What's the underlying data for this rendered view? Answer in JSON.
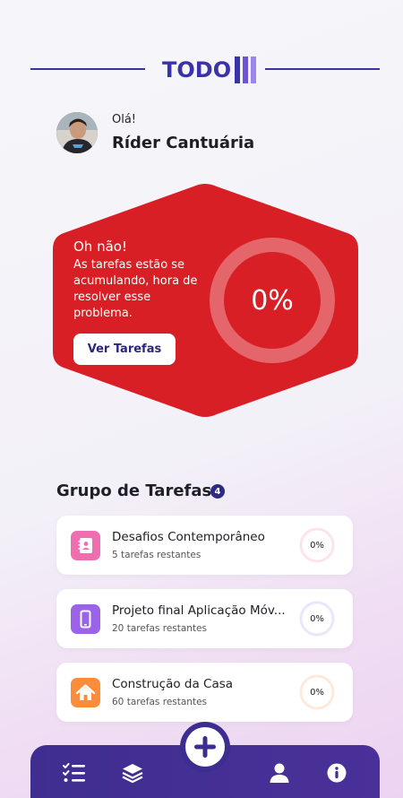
{
  "header": {
    "logo_text": "TODO"
  },
  "greeting": {
    "hello": "Olá!",
    "name": "Ríder Cantuária"
  },
  "hero": {
    "title": "Oh não!",
    "message": "As tarefas estão se acumulando, hora de resolver  esse problema.",
    "button_label": "Ver Tarefas",
    "progress_label": "0%",
    "progress": 0,
    "color": "#d91f26"
  },
  "group": {
    "title": "Grupo de Tarefas",
    "count": "4",
    "tasks": [
      {
        "title": "Desafios Contemporâneo",
        "subtitle": "5 tarefas restantes",
        "progress_label": "0%",
        "progress": 0,
        "icon": "contacts-book-icon",
        "color": "#ef6eb0"
      },
      {
        "title": "Projeto final Aplicação Móv...",
        "subtitle": "20 tarefas restantes",
        "progress_label": "0%",
        "progress": 0,
        "icon": "mobile-phone-icon",
        "color": "#9a63e8"
      },
      {
        "title": "Construção da Casa",
        "subtitle": "60 tarefas restantes",
        "progress_label": "0%",
        "progress": 0,
        "icon": "house-icon",
        "color": "#fb8c3c"
      }
    ]
  },
  "nav": {
    "items": [
      "task-list-icon",
      "layers-icon",
      "add-icon",
      "user-icon",
      "info-icon"
    ],
    "color": "#3f2e8f"
  }
}
